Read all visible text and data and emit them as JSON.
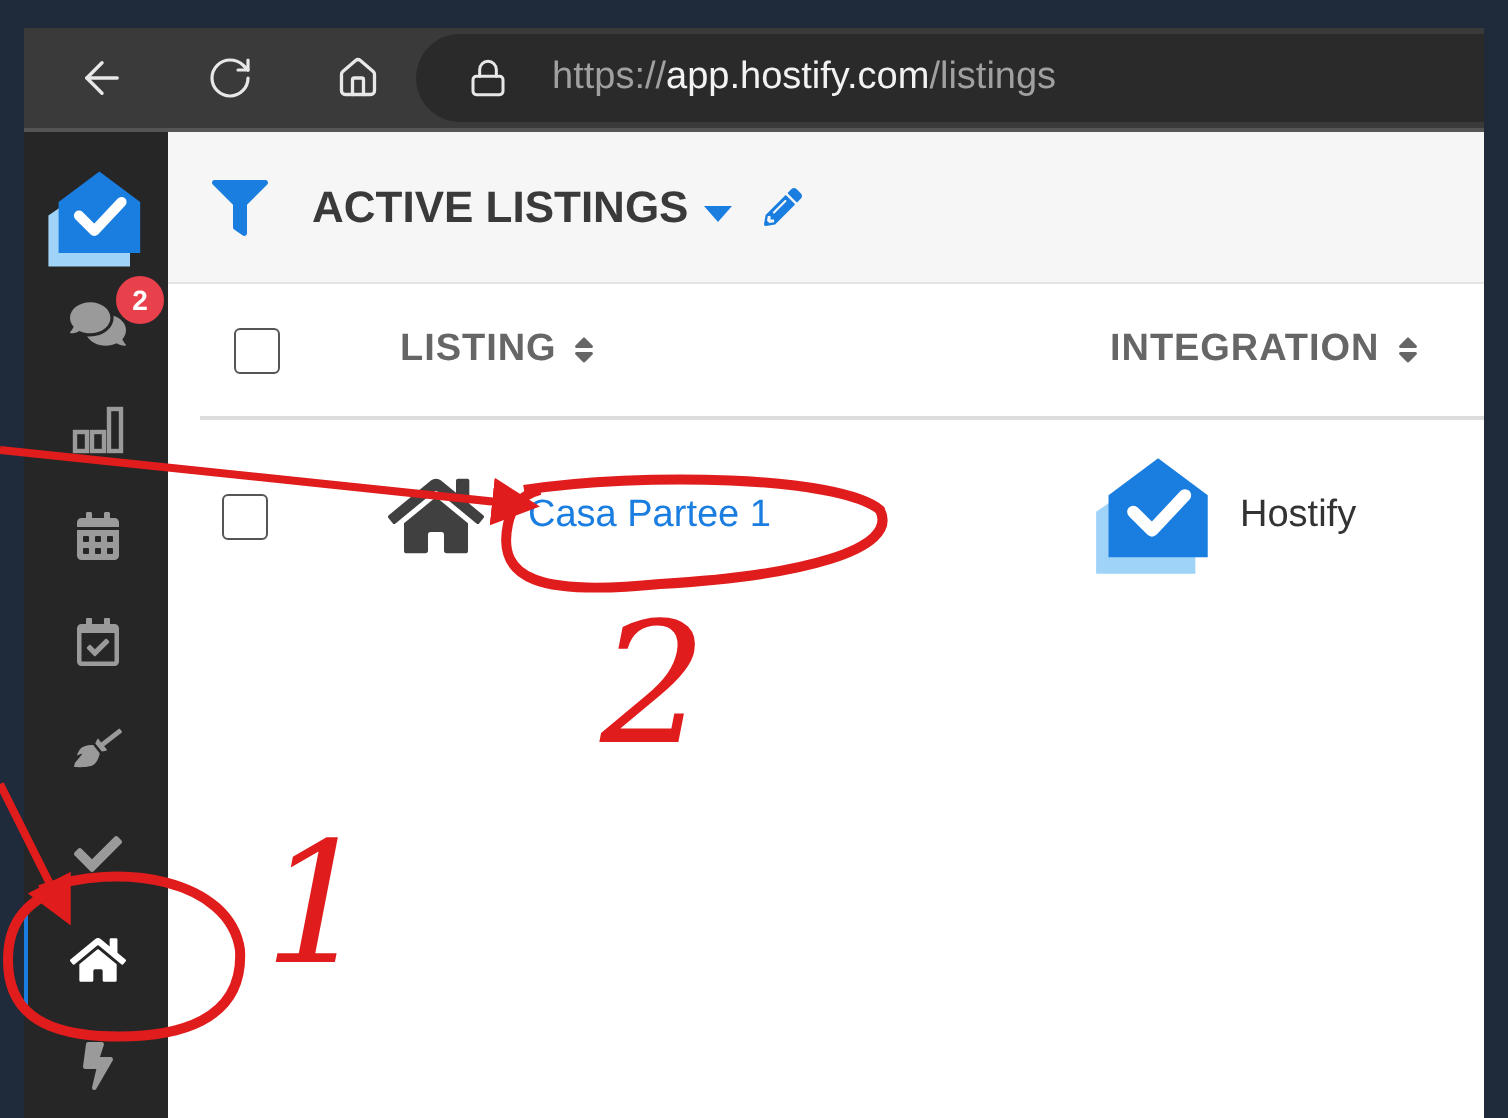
{
  "browser": {
    "url_scheme": "https://",
    "url_host": "app.hostify.com",
    "url_path": "/listings"
  },
  "sidebar": {
    "items": [
      {
        "kind": "chat",
        "badge": "2",
        "selected": false
      },
      {
        "kind": "chart",
        "selected": false
      },
      {
        "kind": "calendar",
        "selected": false
      },
      {
        "kind": "calendar-check",
        "selected": false
      },
      {
        "kind": "broom",
        "selected": false
      },
      {
        "kind": "check",
        "selected": false
      },
      {
        "kind": "home",
        "selected": true
      },
      {
        "kind": "bolt",
        "selected": false
      }
    ]
  },
  "header": {
    "title": "ACTIVE LISTINGS"
  },
  "table": {
    "select_all_checked": false,
    "columns": [
      {
        "label": "LISTING"
      },
      {
        "label": "INTEGRATION"
      }
    ],
    "rows": [
      {
        "checked": false,
        "listing": "Casa Partee 1",
        "integration": "Hostify"
      }
    ]
  },
  "annotations": [
    {
      "label": "2"
    },
    {
      "label": "1"
    }
  ]
}
